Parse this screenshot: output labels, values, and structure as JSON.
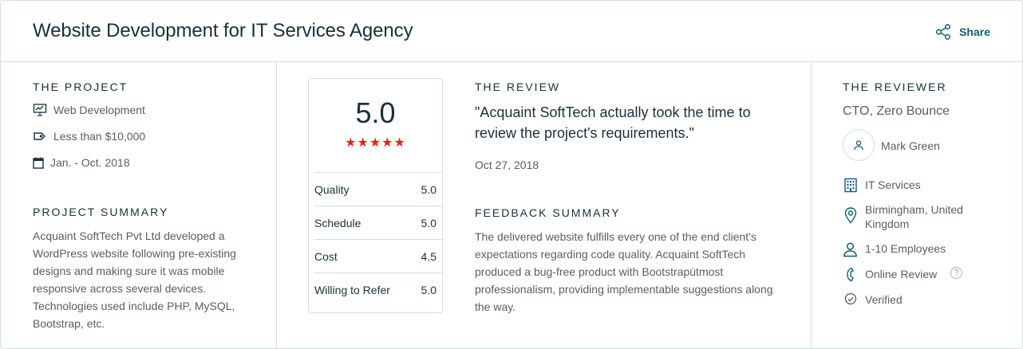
{
  "header": {
    "title": "Website Development for IT Services Agency",
    "share_label": "Share"
  },
  "project": {
    "heading": "THE PROJECT",
    "service": "Web Development",
    "budget": "Less than $10,000",
    "dates": "Jan. - Oct. 2018",
    "summary_heading": "PROJECT SUMMARY",
    "summary_lines": [
      "Acquaint SoftTech Pvt Ltd developed a",
      "WordPress website following pre-existing",
      "designs and making sure it was mobile",
      "responsive across several devices.",
      "Technologies used include PHP, MySQL,",
      "Bootstrap, etc."
    ]
  },
  "rating": {
    "overall": "5.0",
    "stars": 5,
    "rows": [
      {
        "label": "Quality",
        "value": "5.0"
      },
      {
        "label": "Schedule",
        "value": "5.0"
      },
      {
        "label": "Cost",
        "value": "4.5"
      },
      {
        "label": "Willing to Refer",
        "value": "5.0"
      }
    ]
  },
  "review": {
    "heading": "THE REVIEW",
    "quote_lines": [
      "\"Acquaint SoftTech actually took the time to",
      "review the project's requirements.\""
    ],
    "date": "Oct 27, 2018",
    "feedback_heading": "FEEDBACK SUMMARY",
    "feedback_lines": [
      "The delivered website fulfills every one of the end client's",
      "expectations regarding code quality. Acquaint SoftTech",
      "produced a bug-free product with Bootstrapútmost",
      "professionalism, providing implementable suggestions along",
      "the way."
    ]
  },
  "reviewer": {
    "heading": "THE REVIEWER",
    "title": "CTO, Zero Bounce",
    "name": "Mark Green",
    "industry": "IT Services",
    "location_lines": [
      "Birmingham, United",
      "Kingdom"
    ],
    "company_size": "1-10 Employees",
    "review_type": "Online Review",
    "help_glyph": "?",
    "verified": "Verified"
  },
  "colors": {
    "accent": "#0f5d74",
    "star": "#e62415",
    "border": "#cfe0e3",
    "text_dark": "#17313b",
    "text_muted": "#555f66"
  }
}
